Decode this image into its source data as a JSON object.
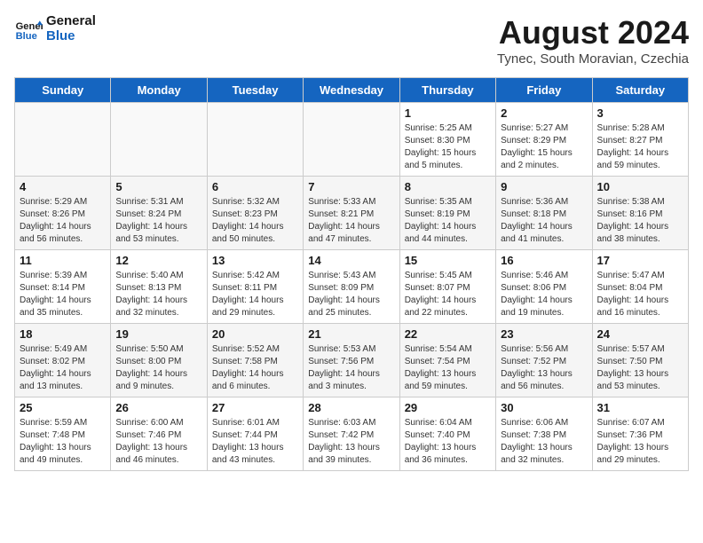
{
  "logo": {
    "line1": "General",
    "line2": "Blue"
  },
  "title": "August 2024",
  "subtitle": "Tynec, South Moravian, Czechia",
  "days_of_week": [
    "Sunday",
    "Monday",
    "Tuesday",
    "Wednesday",
    "Thursday",
    "Friday",
    "Saturday"
  ],
  "weeks": [
    [
      {
        "day": "",
        "info": ""
      },
      {
        "day": "",
        "info": ""
      },
      {
        "day": "",
        "info": ""
      },
      {
        "day": "",
        "info": ""
      },
      {
        "day": "1",
        "info": "Sunrise: 5:25 AM\nSunset: 8:30 PM\nDaylight: 15 hours\nand 5 minutes."
      },
      {
        "day": "2",
        "info": "Sunrise: 5:27 AM\nSunset: 8:29 PM\nDaylight: 15 hours\nand 2 minutes."
      },
      {
        "day": "3",
        "info": "Sunrise: 5:28 AM\nSunset: 8:27 PM\nDaylight: 14 hours\nand 59 minutes."
      }
    ],
    [
      {
        "day": "4",
        "info": "Sunrise: 5:29 AM\nSunset: 8:26 PM\nDaylight: 14 hours\nand 56 minutes."
      },
      {
        "day": "5",
        "info": "Sunrise: 5:31 AM\nSunset: 8:24 PM\nDaylight: 14 hours\nand 53 minutes."
      },
      {
        "day": "6",
        "info": "Sunrise: 5:32 AM\nSunset: 8:23 PM\nDaylight: 14 hours\nand 50 minutes."
      },
      {
        "day": "7",
        "info": "Sunrise: 5:33 AM\nSunset: 8:21 PM\nDaylight: 14 hours\nand 47 minutes."
      },
      {
        "day": "8",
        "info": "Sunrise: 5:35 AM\nSunset: 8:19 PM\nDaylight: 14 hours\nand 44 minutes."
      },
      {
        "day": "9",
        "info": "Sunrise: 5:36 AM\nSunset: 8:18 PM\nDaylight: 14 hours\nand 41 minutes."
      },
      {
        "day": "10",
        "info": "Sunrise: 5:38 AM\nSunset: 8:16 PM\nDaylight: 14 hours\nand 38 minutes."
      }
    ],
    [
      {
        "day": "11",
        "info": "Sunrise: 5:39 AM\nSunset: 8:14 PM\nDaylight: 14 hours\nand 35 minutes."
      },
      {
        "day": "12",
        "info": "Sunrise: 5:40 AM\nSunset: 8:13 PM\nDaylight: 14 hours\nand 32 minutes."
      },
      {
        "day": "13",
        "info": "Sunrise: 5:42 AM\nSunset: 8:11 PM\nDaylight: 14 hours\nand 29 minutes."
      },
      {
        "day": "14",
        "info": "Sunrise: 5:43 AM\nSunset: 8:09 PM\nDaylight: 14 hours\nand 25 minutes."
      },
      {
        "day": "15",
        "info": "Sunrise: 5:45 AM\nSunset: 8:07 PM\nDaylight: 14 hours\nand 22 minutes."
      },
      {
        "day": "16",
        "info": "Sunrise: 5:46 AM\nSunset: 8:06 PM\nDaylight: 14 hours\nand 19 minutes."
      },
      {
        "day": "17",
        "info": "Sunrise: 5:47 AM\nSunset: 8:04 PM\nDaylight: 14 hours\nand 16 minutes."
      }
    ],
    [
      {
        "day": "18",
        "info": "Sunrise: 5:49 AM\nSunset: 8:02 PM\nDaylight: 14 hours\nand 13 minutes."
      },
      {
        "day": "19",
        "info": "Sunrise: 5:50 AM\nSunset: 8:00 PM\nDaylight: 14 hours\nand 9 minutes."
      },
      {
        "day": "20",
        "info": "Sunrise: 5:52 AM\nSunset: 7:58 PM\nDaylight: 14 hours\nand 6 minutes."
      },
      {
        "day": "21",
        "info": "Sunrise: 5:53 AM\nSunset: 7:56 PM\nDaylight: 14 hours\nand 3 minutes."
      },
      {
        "day": "22",
        "info": "Sunrise: 5:54 AM\nSunset: 7:54 PM\nDaylight: 13 hours\nand 59 minutes."
      },
      {
        "day": "23",
        "info": "Sunrise: 5:56 AM\nSunset: 7:52 PM\nDaylight: 13 hours\nand 56 minutes."
      },
      {
        "day": "24",
        "info": "Sunrise: 5:57 AM\nSunset: 7:50 PM\nDaylight: 13 hours\nand 53 minutes."
      }
    ],
    [
      {
        "day": "25",
        "info": "Sunrise: 5:59 AM\nSunset: 7:48 PM\nDaylight: 13 hours\nand 49 minutes."
      },
      {
        "day": "26",
        "info": "Sunrise: 6:00 AM\nSunset: 7:46 PM\nDaylight: 13 hours\nand 46 minutes."
      },
      {
        "day": "27",
        "info": "Sunrise: 6:01 AM\nSunset: 7:44 PM\nDaylight: 13 hours\nand 43 minutes."
      },
      {
        "day": "28",
        "info": "Sunrise: 6:03 AM\nSunset: 7:42 PM\nDaylight: 13 hours\nand 39 minutes."
      },
      {
        "day": "29",
        "info": "Sunrise: 6:04 AM\nSunset: 7:40 PM\nDaylight: 13 hours\nand 36 minutes."
      },
      {
        "day": "30",
        "info": "Sunrise: 6:06 AM\nSunset: 7:38 PM\nDaylight: 13 hours\nand 32 minutes."
      },
      {
        "day": "31",
        "info": "Sunrise: 6:07 AM\nSunset: 7:36 PM\nDaylight: 13 hours\nand 29 minutes."
      }
    ]
  ]
}
